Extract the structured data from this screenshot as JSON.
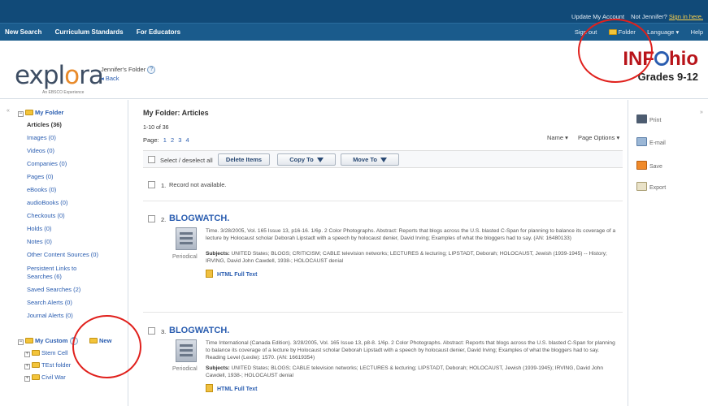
{
  "topbar": {
    "update_account": "Update My Account",
    "not_user": "Not Jennifer?",
    "sign_in": "Sign in here.",
    "nav_left": [
      "New Search",
      "Curriculum Standards",
      "For Educators"
    ],
    "sign_out": "Sign out",
    "folder": "Folder",
    "language": "Language ▾",
    "help": "Help"
  },
  "header": {
    "logo_pre": "expl",
    "logo_o": "o",
    "logo_post": "ra",
    "logo_sub": "An EBSCO Experience",
    "folder_title": "Jennifer's Folder",
    "back": "◂ Back",
    "brand": "INF",
    "brand_post": "hio",
    "grades": "Grades 9-12"
  },
  "sidebar": {
    "my_folder": "My Folder",
    "items": [
      {
        "label": "Articles (36)",
        "active": true
      },
      {
        "label": "Images (0)"
      },
      {
        "label": "Videos (0)"
      },
      {
        "label": "Companies (0)"
      },
      {
        "label": "Pages (0)"
      },
      {
        "label": "eBooks (0)"
      },
      {
        "label": "audioBooks (0)"
      },
      {
        "label": "Checkouts (0)"
      },
      {
        "label": "Holds (0)"
      },
      {
        "label": "Notes (0)"
      },
      {
        "label": "Other Content Sources (0)"
      },
      {
        "label": "Persistent Links to"
      },
      {
        "label": "Searches (6)"
      },
      {
        "label": "Saved Searches (2)"
      },
      {
        "label": "Search Alerts (0)"
      },
      {
        "label": "Journal Alerts (0)"
      }
    ],
    "my_custom": "My Custom",
    "new": "New",
    "custom_items": [
      "Stem Cell",
      "TEst folder",
      "Civil War"
    ]
  },
  "main": {
    "title": "My Folder: Articles",
    "count": "1-10 of 36",
    "page_label": "Page:",
    "pages": [
      "1",
      "2",
      "3",
      "4"
    ],
    "sort": "Name ▾",
    "page_options": "Page Options ▾",
    "select_all": "Select / deselect all",
    "delete": "Delete Items",
    "copy": "Copy To",
    "move": "Move To",
    "records": [
      {
        "num": "1.",
        "text": "Record not available."
      },
      {
        "num": "2.",
        "title": "BLOGWATCH.",
        "type": "Periodical",
        "abstract": "Time. 3/28/2005, Vol. 165 Issue 13, p16-16. 1/6p. 2 Color Photographs. Abstract: Reports that blogs across the U.S. blasted C-Span for planning to balance its coverage of a lecture by Holocaust scholar Deborah Lipstadt with a speech by holocaust denier, David Irving; Examples of what the bloggers had to say. (AN: 16480133)",
        "subjects_label": "Subjects:",
        "subjects": "UNITED States; BLOGS; CRITICISM; CABLE television networks; LECTURES & lecturing; LIPSTADT, Deborah; HOLOCAUST, Jewish (1939-1945) -- History; IRVING, David John Cawdell, 1938-; HOLOCAUST denial",
        "full_text": "HTML Full Text"
      },
      {
        "num": "3.",
        "title": "BLOGWATCH.",
        "type": "Periodical",
        "abstract": "Time International (Canada Edition). 3/28/2005, Vol. 165 Issue 13, p8-8. 1/6p. 2 Color Photographs. Abstract: Reports that blogs across the U.S. blasted C-Span for planning to balance its coverage of a lecture by Holocaust scholar Deborah Lipstadt with a speech by holocaust denier, David Irving; Examples of what the bloggers had to say. Reading Level (Lexile): 1570. (AN: 16619354)",
        "subjects_label": "Subjects:",
        "subjects": "UNITED States; BLOGS; CABLE television networks; LECTURES & lecturing; LIPSTADT, Deborah; HOLOCAUST, Jewish (1939-1945); IRVING, David John Cawdell, 1938-; HOLOCAUST denial",
        "full_text": "HTML Full Text"
      }
    ]
  },
  "tools": [
    "Print",
    "E-mail",
    "Save",
    "Export"
  ],
  "colors": {
    "topbar": "#114a78",
    "nav": "#1a5b8c",
    "link": "#2a5db0",
    "annotation": "#e0201c"
  }
}
